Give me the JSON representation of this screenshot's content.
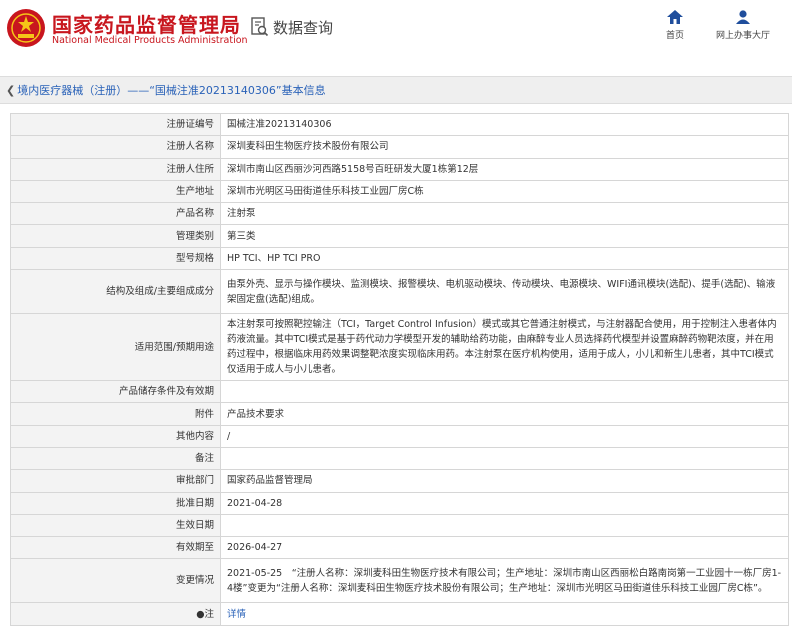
{
  "header": {
    "brand_cn": "国家药品监督管理局",
    "brand_en": "National Medical Products Administration",
    "query_label": "数据查询",
    "nav": {
      "home": "首页",
      "online_hall": "网上办事大厅"
    },
    "colors": {
      "brand_red": "#c8161e",
      "link_blue": "#2a62b8"
    }
  },
  "breadcrumb": "境内医疗器械（注册）——“国械注准20213140306”基本信息",
  "rows": [
    {
      "label": "注册证编号",
      "value": "国械注准20213140306"
    },
    {
      "label": "注册人名称",
      "value": "深圳麦科田生物医疗技术股份有限公司"
    },
    {
      "label": "注册人住所",
      "value": "深圳市南山区西丽沙河西路5158号百旺研发大厦1栋第12层"
    },
    {
      "label": "生产地址",
      "value": "深圳市光明区马田街道佳乐科技工业园厂房C栋"
    },
    {
      "label": "产品名称",
      "value": "注射泵"
    },
    {
      "label": "管理类别",
      "value": "第三类"
    },
    {
      "label": "型号规格",
      "value": "HP TCI、HP TCI PRO"
    },
    {
      "label": "结构及组成/主要组成成分",
      "value": "由泵外壳、显示与操作模块、监测模块、报警模块、电机驱动模块、传动模块、电源模块、WIFI通讯模块(选配)、提手(选配)、输液架固定盘(选配)组成。"
    },
    {
      "label": "适用范围/预期用途",
      "value": "本注射泵可按照靶控输注（TCI，Target Control Infusion）模式或其它普通注射模式，与注射器配合使用，用于控制注入患者体内药液流量。其中TCI模式是基于药代动力学模型开发的辅助给药功能，由麻醉专业人员选择药代模型并设置麻醉药物靶浓度，并在用药过程中，根据临床用药效果调整靶浓度实现临床用药。本注射泵在医疗机构使用，适用于成人，小儿和新生儿患者，其中TCI模式仅适用于成人与小儿患者。"
    },
    {
      "label": "产品储存条件及有效期",
      "value": ""
    },
    {
      "label": "附件",
      "value": "产品技术要求"
    },
    {
      "label": "其他内容",
      "value": "/"
    },
    {
      "label": "备注",
      "value": ""
    },
    {
      "label": "审批部门",
      "value": "国家药品监督管理局"
    },
    {
      "label": "批准日期",
      "value": "2021-04-28"
    },
    {
      "label": "生效日期",
      "value": ""
    },
    {
      "label": "有效期至",
      "value": "2026-04-27"
    },
    {
      "label": "变更情况",
      "value": "2021-05-25　“注册人名称：深圳麦科田生物医疗技术有限公司；生产地址：深圳市南山区西丽松白路南岗第一工业园十一栋厂房1-4楼”变更为“注册人名称：深圳麦科田生物医疗技术股份有限公司；生产地址：深圳市光明区马田街道佳乐科技工业园厂房C栋”。"
    },
    {
      "label": "●注",
      "value": "详情"
    }
  ]
}
